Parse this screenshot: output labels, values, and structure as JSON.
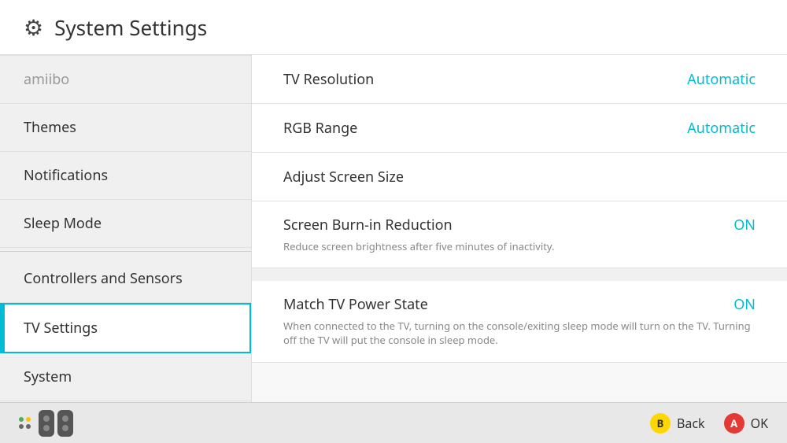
{
  "header": {
    "title": "System Settings",
    "icon": "⚙"
  },
  "sidebar": {
    "items": [
      {
        "id": "amiibo",
        "label": "amiibo",
        "selected": false,
        "faded": true
      },
      {
        "id": "themes",
        "label": "Themes",
        "selected": false,
        "faded": false
      },
      {
        "id": "notifications",
        "label": "Notifications",
        "selected": false,
        "faded": false
      },
      {
        "id": "sleep-mode",
        "label": "Sleep Mode",
        "selected": false,
        "faded": false
      },
      {
        "id": "controllers-sensors",
        "label": "Controllers and Sensors",
        "selected": false,
        "faded": false
      },
      {
        "id": "tv-settings",
        "label": "TV Settings",
        "selected": true,
        "faded": false
      },
      {
        "id": "system",
        "label": "System",
        "selected": false,
        "faded": false
      }
    ]
  },
  "content": {
    "settings": [
      {
        "id": "tv-resolution",
        "label": "TV Resolution",
        "value": "Automatic",
        "description": null
      },
      {
        "id": "rgb-range",
        "label": "RGB Range",
        "value": "Automatic",
        "description": null
      },
      {
        "id": "adjust-screen-size",
        "label": "Adjust Screen Size",
        "value": null,
        "description": null
      },
      {
        "id": "screen-burn-in-reduction",
        "label": "Screen Burn-in Reduction",
        "value": "ON",
        "description": "Reduce screen brightness after five minutes of inactivity."
      },
      {
        "id": "match-tv-power-state",
        "label": "Match TV Power State",
        "value": "ON",
        "description": "When connected to the TV, turning on the console/exiting sleep mode will turn on the TV. Turning off the TV will put the console in sleep mode."
      }
    ]
  },
  "footer": {
    "back_label": "Back",
    "ok_label": "OK",
    "b_button": "B",
    "a_button": "A"
  }
}
